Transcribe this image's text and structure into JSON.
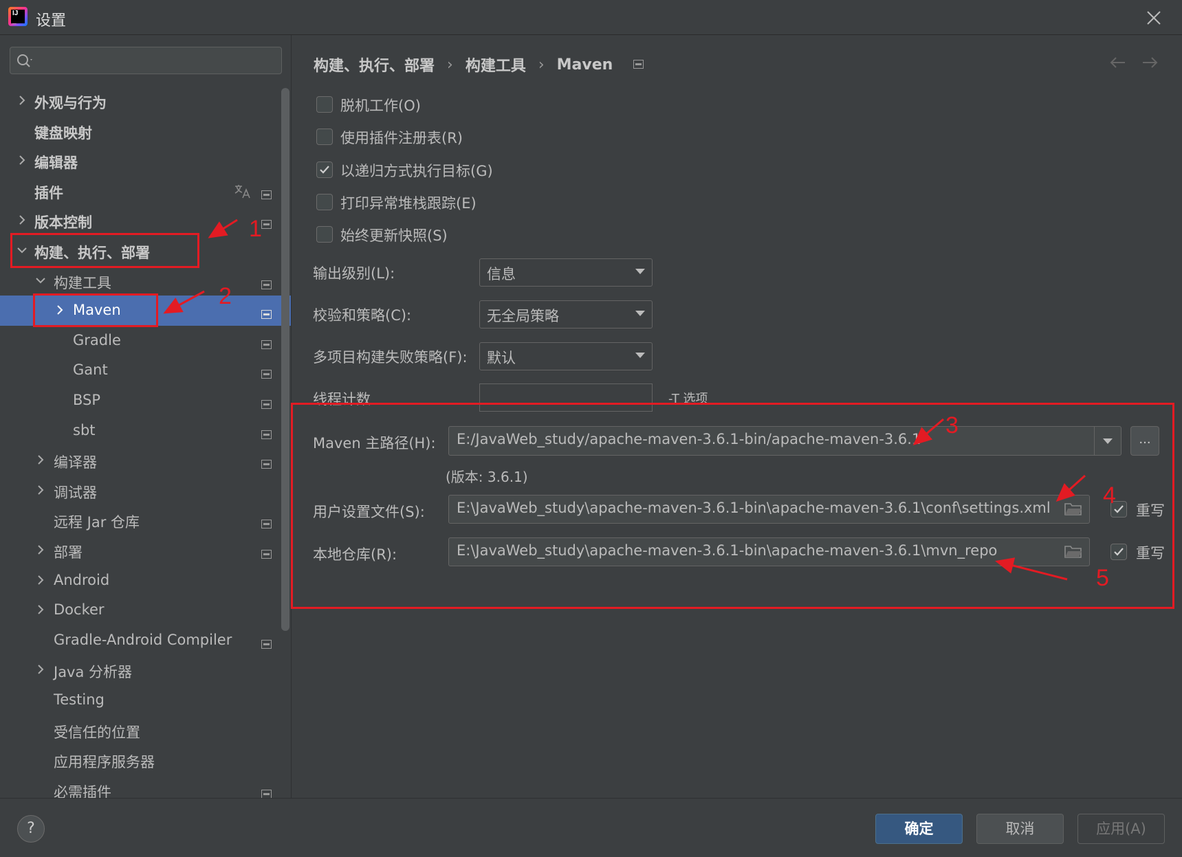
{
  "window": {
    "title": "设置"
  },
  "search": {
    "placeholder": ""
  },
  "tree": [
    {
      "label": "外观与行为",
      "level": 0,
      "chevron": "right",
      "bold": true,
      "proj_icon": false
    },
    {
      "label": "键盘映射",
      "level": 0,
      "chevron": "none",
      "bold": true,
      "proj_icon": false
    },
    {
      "label": "编辑器",
      "level": 0,
      "chevron": "right",
      "bold": true,
      "proj_icon": false
    },
    {
      "label": "插件",
      "level": 0,
      "chevron": "none",
      "bold": true,
      "proj_icon": true,
      "translate_icon": true
    },
    {
      "label": "版本控制",
      "level": 0,
      "chevron": "right",
      "bold": true,
      "proj_icon": true
    },
    {
      "label": "构建、执行、部署",
      "level": 0,
      "chevron": "down",
      "bold": true,
      "proj_icon": false
    },
    {
      "label": "构建工具",
      "level": 1,
      "chevron": "down",
      "bold": false,
      "proj_icon": true
    },
    {
      "label": "Maven",
      "level": 2,
      "chevron": "right",
      "bold": false,
      "proj_icon": true,
      "selected": true
    },
    {
      "label": "Gradle",
      "level": 2,
      "chevron": "none",
      "bold": false,
      "proj_icon": true
    },
    {
      "label": "Gant",
      "level": 2,
      "chevron": "none",
      "bold": false,
      "proj_icon": true
    },
    {
      "label": "BSP",
      "level": 2,
      "chevron": "none",
      "bold": false,
      "proj_icon": true
    },
    {
      "label": "sbt",
      "level": 2,
      "chevron": "none",
      "bold": false,
      "proj_icon": true
    },
    {
      "label": "编译器",
      "level": 1,
      "chevron": "right",
      "bold": false,
      "proj_icon": true
    },
    {
      "label": "调试器",
      "level": 1,
      "chevron": "right",
      "bold": false,
      "proj_icon": false
    },
    {
      "label": "远程 Jar 仓库",
      "level": 1,
      "chevron": "none",
      "bold": false,
      "proj_icon": true
    },
    {
      "label": "部署",
      "level": 1,
      "chevron": "right",
      "bold": false,
      "proj_icon": true
    },
    {
      "label": "Android",
      "level": 1,
      "chevron": "right",
      "bold": false,
      "proj_icon": false
    },
    {
      "label": "Docker",
      "level": 1,
      "chevron": "right",
      "bold": false,
      "proj_icon": false
    },
    {
      "label": "Gradle-Android Compiler",
      "level": 1,
      "chevron": "none",
      "bold": false,
      "proj_icon": true
    },
    {
      "label": "Java 分析器",
      "level": 1,
      "chevron": "right",
      "bold": false,
      "proj_icon": false
    },
    {
      "label": "Testing",
      "level": 1,
      "chevron": "none",
      "bold": false,
      "proj_icon": false
    },
    {
      "label": "受信任的位置",
      "level": 1,
      "chevron": "none",
      "bold": false,
      "proj_icon": false
    },
    {
      "label": "应用程序服务器",
      "level": 1,
      "chevron": "none",
      "bold": false,
      "proj_icon": false
    },
    {
      "label": "必需插件",
      "level": 1,
      "chevron": "none",
      "bold": false,
      "proj_icon": true
    }
  ],
  "breadcrumb": {
    "items": [
      "构建、执行、部署",
      "构建工具",
      "Maven"
    ],
    "separator": "›"
  },
  "options": {
    "offline": {
      "label": "脱机工作(O)",
      "checked": false
    },
    "plugin_registry": {
      "label": "使用插件注册表(R)",
      "checked": false
    },
    "recursive": {
      "label": "以递归方式执行目标(G)",
      "checked": true
    },
    "print_stack": {
      "label": "打印异常堆栈跟踪(E)",
      "checked": false
    },
    "always_update": {
      "label": "始终更新快照(S)",
      "checked": false
    }
  },
  "fields": {
    "output_level": {
      "label": "输出级别(L):",
      "value": "信息"
    },
    "checksum_policy": {
      "label": "校验和策略(C):",
      "value": "无全局策略"
    },
    "multiproject_fail": {
      "label": "多项目构建失败策略(F):",
      "value": "默认"
    },
    "threads": {
      "label": "线程计数",
      "value": "",
      "hint": "-T 选项"
    },
    "maven_home": {
      "label": "Maven 主路径(H):",
      "value": "E:/JavaWeb_study/apache-maven-3.6.1-bin/apache-maven-3.6.1",
      "browse": "...",
      "version": "(版本: 3.6.1)"
    },
    "user_settings": {
      "label": "用户设置文件(S):",
      "value": "E:\\JavaWeb_study\\apache-maven-3.6.1-bin\\apache-maven-3.6.1\\conf\\settings.xml",
      "override_label": "重写",
      "override": true
    },
    "local_repo": {
      "label": "本地仓库(R):",
      "value": "E:\\JavaWeb_study\\apache-maven-3.6.1-bin\\apache-maven-3.6.1\\mvn_repo",
      "override_label": "重写",
      "override": true
    }
  },
  "annotations": {
    "n1": "1",
    "n2": "2",
    "n3": "3",
    "n4": "4",
    "n5": "5",
    "color": "#e31b23"
  },
  "buttons": {
    "help": "?",
    "ok": "确定",
    "cancel": "取消",
    "apply": "应用(A)"
  },
  "colors": {
    "selection": "#4b6eaf",
    "ok_button": "#365880",
    "background": "#3c3f41"
  },
  "icons": {
    "app": "intellij-idea-icon",
    "close": "close-icon",
    "search": "search-icon",
    "project_scope": "project-scope-icon",
    "translate": "translate-icon",
    "folder": "folder-icon",
    "back": "arrow-left-icon",
    "forward": "arrow-right-icon"
  }
}
